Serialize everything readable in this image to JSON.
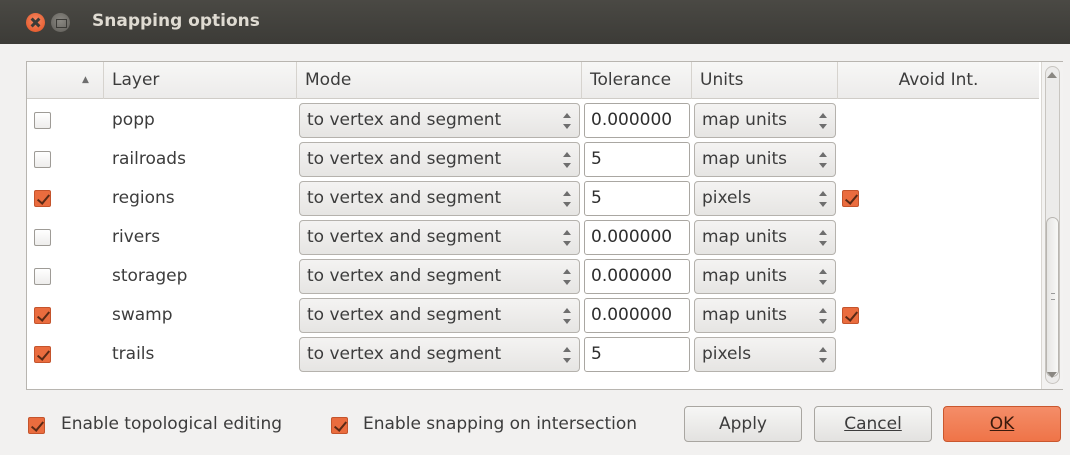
{
  "window": {
    "title": "Snapping options"
  },
  "table": {
    "columns": [
      {
        "label": ""
      },
      {
        "label": "Layer"
      },
      {
        "label": "Mode"
      },
      {
        "label": "Tolerance"
      },
      {
        "label": "Units"
      },
      {
        "label": "Avoid Int."
      }
    ],
    "rows": [
      {
        "enabled": false,
        "layer": "popp",
        "mode": "to vertex and segment",
        "tolerance": "0.000000",
        "units": "map units",
        "avoid": null
      },
      {
        "enabled": false,
        "layer": "railroads",
        "mode": "to vertex and segment",
        "tolerance": "5",
        "units": "map units",
        "avoid": null
      },
      {
        "enabled": true,
        "layer": "regions",
        "mode": "to vertex and segment",
        "tolerance": "5",
        "units": "pixels",
        "avoid": true
      },
      {
        "enabled": false,
        "layer": "rivers",
        "mode": "to vertex and segment",
        "tolerance": "0.000000",
        "units": "map units",
        "avoid": null
      },
      {
        "enabled": false,
        "layer": "storagep",
        "mode": "to vertex and segment",
        "tolerance": "0.000000",
        "units": "map units",
        "avoid": null
      },
      {
        "enabled": true,
        "layer": "swamp",
        "mode": "to vertex and segment",
        "tolerance": "0.000000",
        "units": "map units",
        "avoid": true
      },
      {
        "enabled": true,
        "layer": "trails",
        "mode": "to vertex and segment",
        "tolerance": "5",
        "units": "pixels",
        "avoid": null
      }
    ]
  },
  "options": {
    "topological_editing": {
      "label": "Enable topological editing",
      "checked": true
    },
    "snapping_on_intersection": {
      "label": "Enable snapping on intersection",
      "checked": true
    }
  },
  "buttons": {
    "apply": "Apply",
    "cancel": "Cancel",
    "ok": "OK"
  },
  "colors": {
    "accent": "#ea6c3e",
    "titlebar": "#3c3b37",
    "background": "#f2f1f0"
  }
}
